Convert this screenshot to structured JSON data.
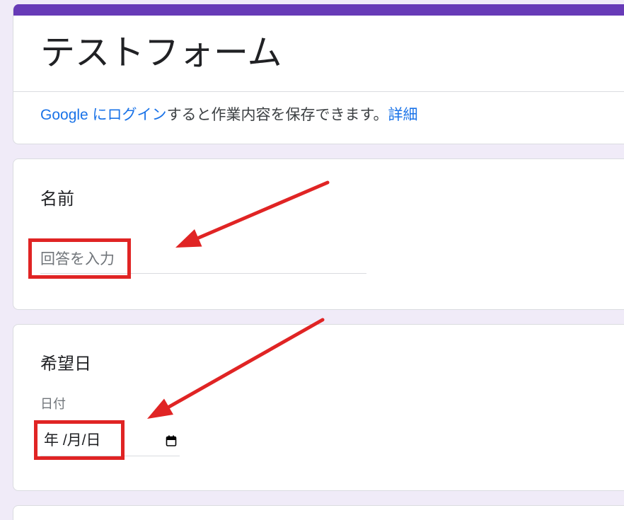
{
  "colors": {
    "accent": "#673ab7",
    "background": "#f0ebf8",
    "link": "#1a73e8",
    "annotation": "#e02424"
  },
  "form": {
    "title": "テストフォーム",
    "login_notice": {
      "link_text": "Google にログイン",
      "text": "すると作業内容を保存できます。",
      "details_link": "詳細"
    }
  },
  "questions": [
    {
      "title": "名前",
      "input": {
        "placeholder": "回答を入力",
        "value": ""
      }
    },
    {
      "title": "希望日",
      "sublabel": "日付",
      "date_input": {
        "placeholder": "年 /月/日",
        "icon": "calendar-icon"
      }
    }
  ]
}
